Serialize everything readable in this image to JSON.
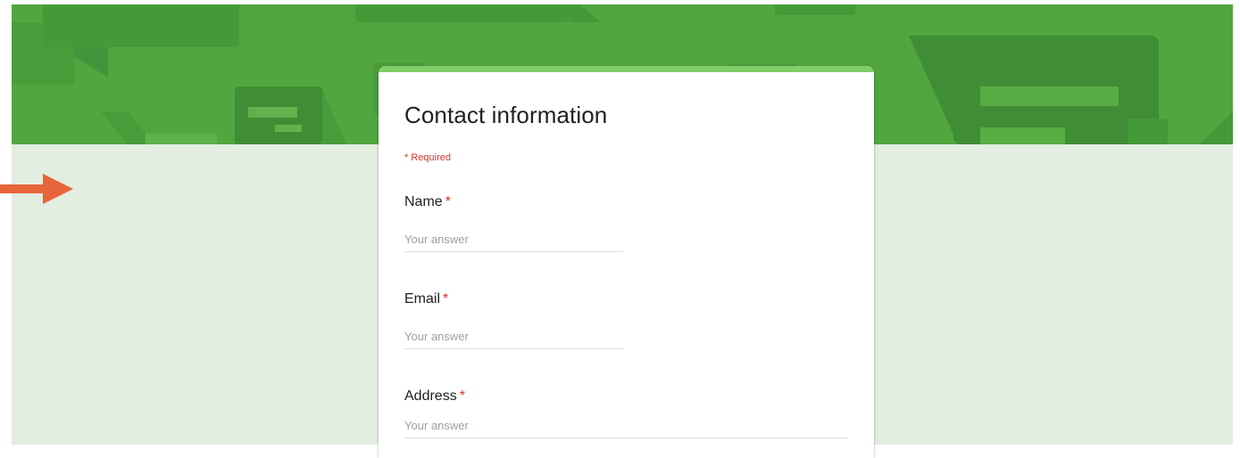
{
  "colors": {
    "banner": "#51a63f",
    "banner_dark": "#43943a",
    "banner_light": "#5fb24c",
    "card_accent": "#7fcd68",
    "content_background": "#e3ede0",
    "required": "#d93025",
    "pointer_arrow": "#e8643a"
  },
  "form": {
    "title": "Contact information",
    "required_note": "* Required",
    "questions": [
      {
        "label": "Name",
        "required_mark": "*",
        "placeholder": "Your answer",
        "value": ""
      },
      {
        "label": "Email",
        "required_mark": "*",
        "placeholder": "Your answer",
        "value": ""
      },
      {
        "label": "Address",
        "required_mark": "*",
        "placeholder": "Your answer",
        "value": ""
      }
    ]
  },
  "icons": {
    "pointer": "right-arrow-icon"
  }
}
